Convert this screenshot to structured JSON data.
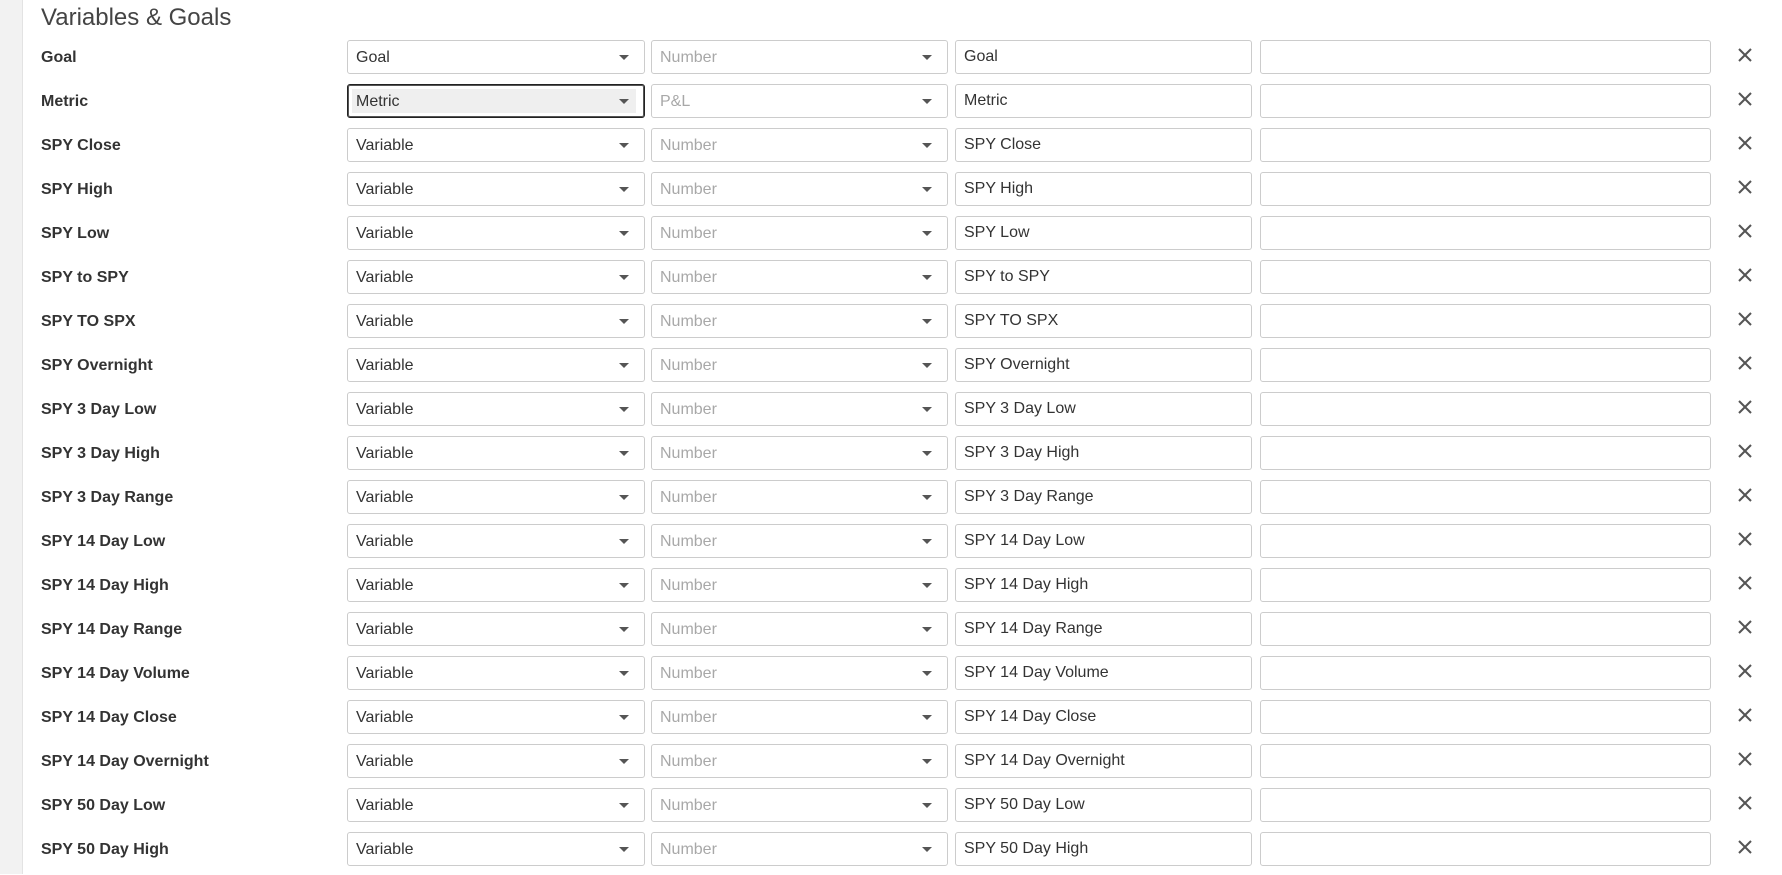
{
  "section": {
    "title": "Variables & Goals"
  },
  "rows": [
    {
      "label": "Goal",
      "type": "Goal",
      "format": "Number",
      "name": "Goal",
      "value": ""
    },
    {
      "label": "Metric",
      "type": "Metric",
      "format": "P&L",
      "name": "Metric",
      "value": ""
    },
    {
      "label": "SPY Close",
      "type": "Variable",
      "format": "Number",
      "name": "SPY Close",
      "value": ""
    },
    {
      "label": "SPY High",
      "type": "Variable",
      "format": "Number",
      "name": "SPY High",
      "value": ""
    },
    {
      "label": "SPY Low",
      "type": "Variable",
      "format": "Number",
      "name": "SPY Low",
      "value": ""
    },
    {
      "label": "SPY to SPY",
      "type": "Variable",
      "format": "Number",
      "name": "SPY to SPY",
      "value": ""
    },
    {
      "label": "SPY TO SPX",
      "type": "Variable",
      "format": "Number",
      "name": "SPY TO SPX",
      "value": ""
    },
    {
      "label": "SPY Overnight",
      "type": "Variable",
      "format": "Number",
      "name": "SPY Overnight",
      "value": ""
    },
    {
      "label": "SPY 3 Day Low",
      "type": "Variable",
      "format": "Number",
      "name": "SPY 3 Day Low",
      "value": ""
    },
    {
      "label": "SPY 3 Day High",
      "type": "Variable",
      "format": "Number",
      "name": "SPY 3 Day High",
      "value": ""
    },
    {
      "label": "SPY 3 Day Range",
      "type": "Variable",
      "format": "Number",
      "name": "SPY 3 Day Range",
      "value": ""
    },
    {
      "label": "SPY 14 Day Low",
      "type": "Variable",
      "format": "Number",
      "name": "SPY 14 Day Low",
      "value": ""
    },
    {
      "label": "SPY 14 Day High",
      "type": "Variable",
      "format": "Number",
      "name": "SPY 14 Day High",
      "value": ""
    },
    {
      "label": "SPY 14 Day Range",
      "type": "Variable",
      "format": "Number",
      "name": "SPY 14 Day Range",
      "value": ""
    },
    {
      "label": "SPY 14 Day Volume",
      "type": "Variable",
      "format": "Number",
      "name": "SPY 14 Day Volume",
      "value": ""
    },
    {
      "label": "SPY 14 Day Close",
      "type": "Variable",
      "format": "Number",
      "name": "SPY 14 Day Close",
      "value": ""
    },
    {
      "label": "SPY 14 Day Overnight",
      "type": "Variable",
      "format": "Number",
      "name": "SPY 14 Day Overnight",
      "value": ""
    },
    {
      "label": "SPY 50 Day Low",
      "type": "Variable",
      "format": "Number",
      "name": "SPY 50 Day Low",
      "value": ""
    },
    {
      "label": "SPY 50 Day High",
      "type": "Variable",
      "format": "Number",
      "name": "SPY 50 Day High",
      "value": ""
    }
  ],
  "icons": {
    "remove": "close-icon",
    "dropdown": "chevron-down-icon"
  },
  "colors": {
    "border": "#cccccc",
    "placeholder_text": "#a8a8a8",
    "label_text": "#333333",
    "icon": "#555555"
  }
}
